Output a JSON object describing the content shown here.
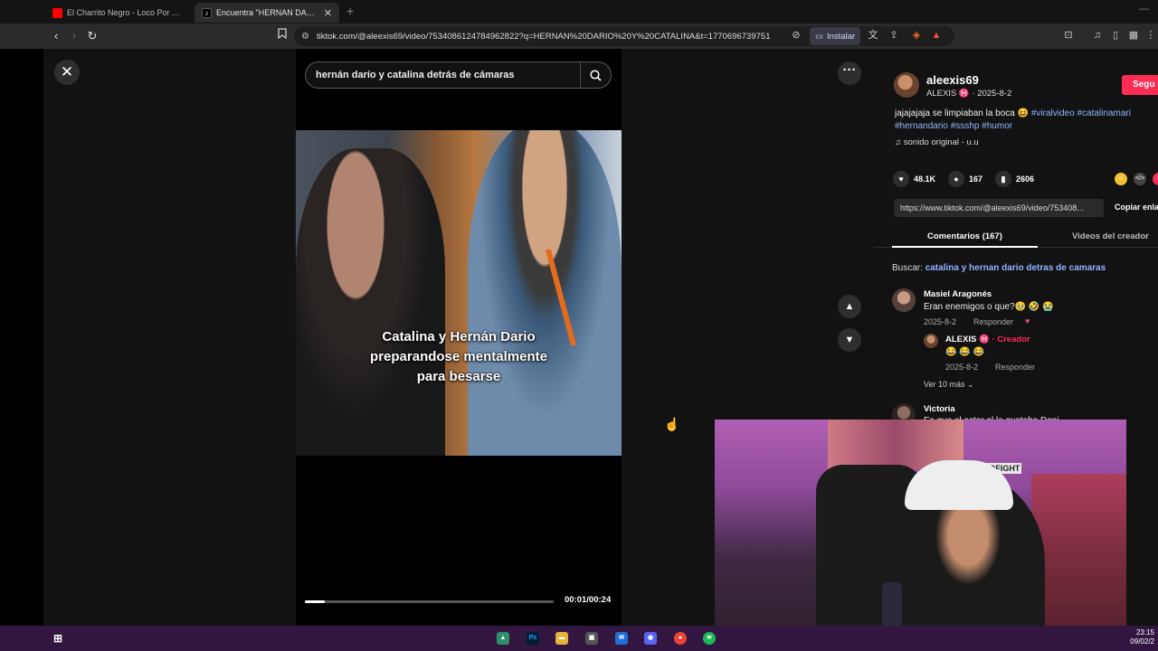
{
  "browser": {
    "tabs": [
      {
        "title": "El Charrito Negro - Loco Por Amor (V",
        "active": false
      },
      {
        "title": "Encuentra \"HERNAN DARIO Y",
        "active": true
      }
    ],
    "new_tab": "+",
    "url": "tiktok.com/@aleexis69/video/7534086124784962822?q=HERNAN%20DARIO%20Y%20CATALINA&t=1770696739751",
    "install_label": "Instalar"
  },
  "viewer": {
    "search_query": "hernán darío y catalina detrás de cámaras",
    "caption_lines": [
      "Catalina y Hernán Dario",
      "preparandose mentalmente",
      "para besarse"
    ],
    "time": "00:01/00:24",
    "progress": 0.08
  },
  "panel": {
    "username": "aleexis69",
    "display_name": "ALEXIS ♓",
    "date": "2025-8-2",
    "follow_label": "Segu",
    "description_text": "jajajajaja se limpiaban la boca 😆 ",
    "description_tags": "#viralvideo #catalinamari #hernandario #ssshp #humor",
    "sound": "sonido original - u.u",
    "likes": "48.1K",
    "comments": "167",
    "saves": "2606",
    "share_link": "https://www.tiktok.com/@aleexis69/video/753408...",
    "copy_link_label": "Copiar enla",
    "tab_comments": "Comentarios (167)",
    "tab_creator": "Videos del creador",
    "search_prefix": "Buscar: ",
    "search_suggestion": "catalina y hernan dario detras de camaras"
  },
  "comments": [
    {
      "author": "Masiel Aragonés",
      "text": "Eran enemigos o que?🥹 🤣 😭",
      "date": "2025-8-2",
      "reply_label": "Responder"
    },
    {
      "author": "ALEXIS ♓",
      "badge": "Creador",
      "text": "😂 😂 😂",
      "date": "2025-8-2",
      "reply_label": "Responder"
    },
    {
      "author": "Victoria",
      "text": "Es que el actor al le gustaba Dani"
    }
  ],
  "view_more": "Ver 10 más",
  "webcam": {
    "poster_text": "DTODOFIGHT"
  },
  "taskbar": {
    "time": "23:15",
    "date": "09/02/2"
  },
  "colors": {
    "accent": "#fe2c55",
    "link": "#8fb6ff",
    "taskbar": "#321640"
  }
}
